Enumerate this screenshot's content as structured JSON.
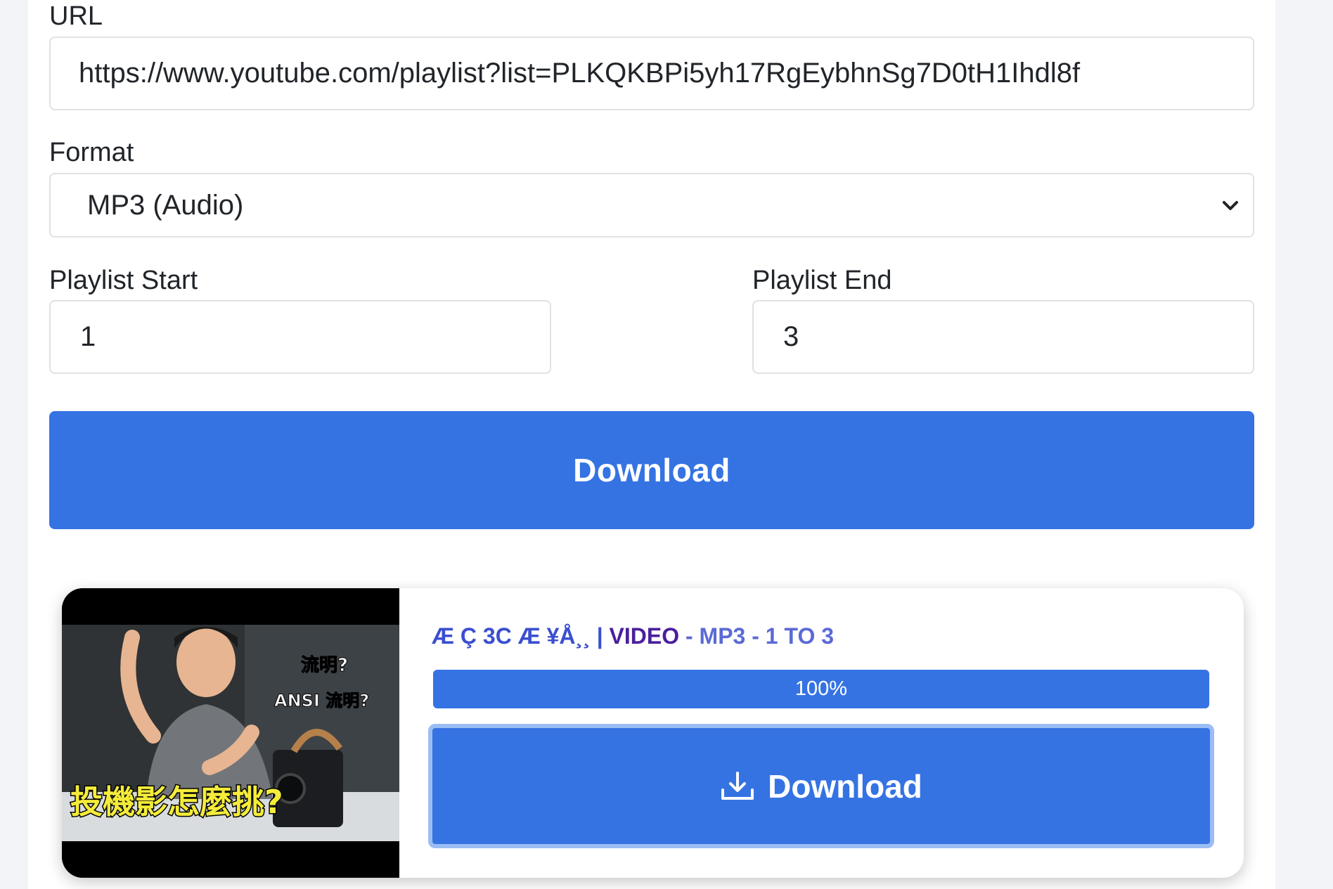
{
  "form": {
    "url_label": "URL",
    "url_value": "https://www.youtube.com/playlist?list=PLKQKBPi5yh17RgEybhnSg7D0tH1Ihdl8f",
    "format_label": "Format",
    "format_value": "MP3 (Audio)",
    "playlist_start_label": "Playlist Start",
    "playlist_start_value": "1",
    "playlist_end_label": "Playlist End",
    "playlist_end_value": "3",
    "download_label": "Download"
  },
  "result": {
    "title_garbled": "Æ   Ç   3C Æ  ¥Å¸¸ |",
    "title_video": "VIDEO",
    "title_suffix": "- MP3 - 1 TO 3",
    "progress_percent": 100,
    "progress_label": "100%",
    "download_label": "Download",
    "thumbnail": {
      "text_lumens": "流明?",
      "text_ansi": "ANSI 流明?",
      "text_main": "投機影怎麼挑?"
    }
  },
  "colors": {
    "primary": "#3573e3",
    "primary_border": "#9bbdf4",
    "page_bg": "#f3f4f8"
  },
  "icons": {
    "select_arrow": "chevron-down-icon",
    "download": "download-icon"
  }
}
